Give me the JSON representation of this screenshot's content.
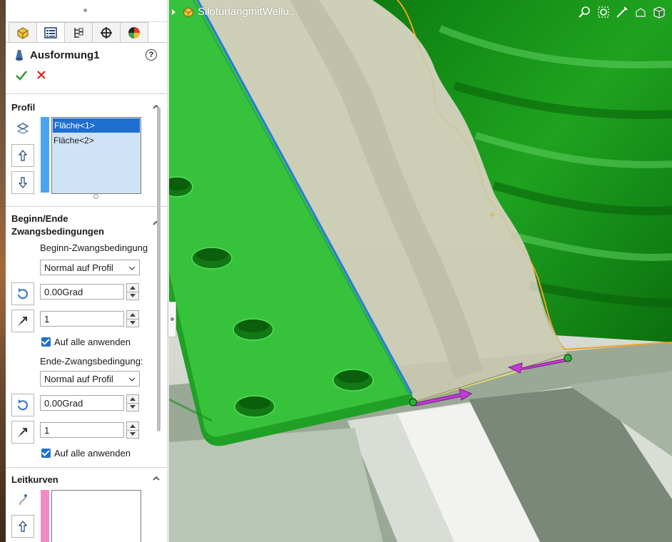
{
  "feature": {
    "title": "Ausformung1",
    "help": "?"
  },
  "tree": {
    "part_name": "SiloturlangmitWellu..."
  },
  "profile": {
    "section_title": "Profil",
    "items": [
      "Fläche<1>",
      "Fläche<2>"
    ],
    "selected_index": 0,
    "color": "#4aa3f0"
  },
  "constraints": {
    "section_title_line1": "Beginn/Ende",
    "section_title_line2": "Zwangsbedingungen",
    "start": {
      "label": "Beginn-Zwangsbedingung",
      "type": "Normal auf Profil",
      "angle": "0.00Grad",
      "length": "1",
      "apply_all_label": "Auf alle anwenden",
      "apply_all_checked": true
    },
    "end": {
      "label": "Ende-Zwangsbedingung:",
      "type": "Normal auf Profil",
      "angle": "0.00Grad",
      "length": "1",
      "apply_all_label": "Auf alle anwenden",
      "apply_all_checked": true
    }
  },
  "guides": {
    "section_title": "Leitkurven",
    "color": "#f08bc8"
  },
  "colors": {
    "accent": "#1f6fd1",
    "model_green": "#35c43c",
    "handle_magenta": "#c23bd4"
  }
}
